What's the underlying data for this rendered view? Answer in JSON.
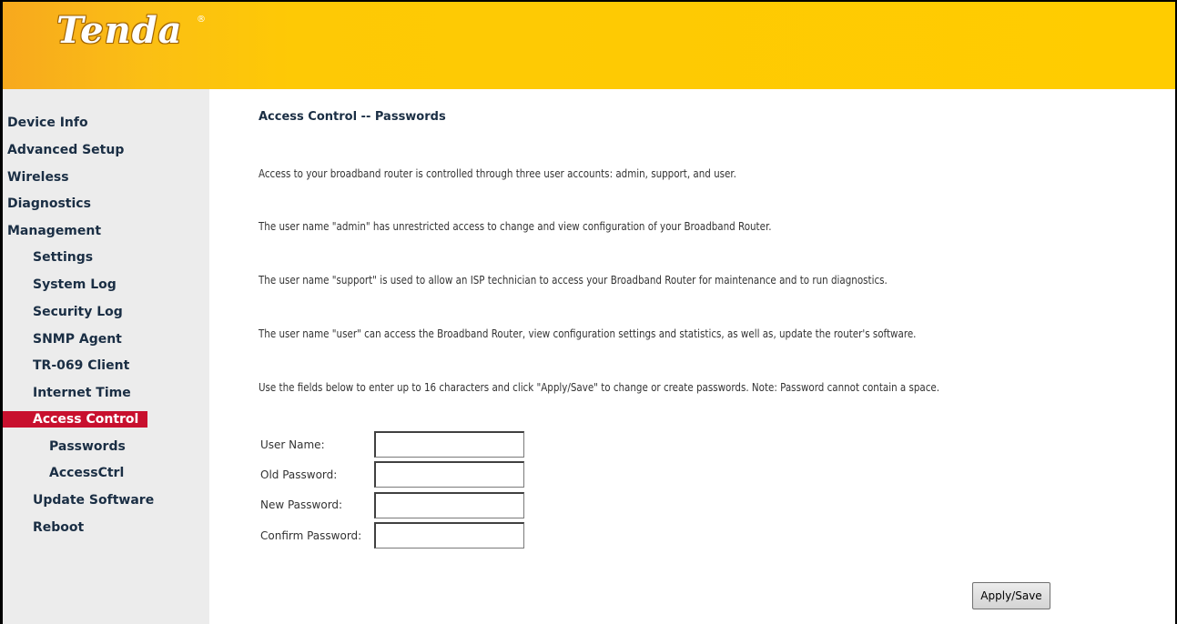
{
  "brand": {
    "logo": "Tenda",
    "reg_mark": "®",
    "header_color": "#ffcc00",
    "accent": "#c8102e"
  },
  "sidebar": {
    "items": [
      {
        "label": "Device Info"
      },
      {
        "label": "Advanced Setup"
      },
      {
        "label": "Wireless"
      },
      {
        "label": "Diagnostics"
      },
      {
        "label": "Management"
      },
      {
        "label": "Settings"
      },
      {
        "label": "System Log"
      },
      {
        "label": "Security Log"
      },
      {
        "label": "SNMP Agent"
      },
      {
        "label": "TR-069 Client"
      },
      {
        "label": "Internet Time"
      },
      {
        "label": "Access Control"
      },
      {
        "label": "Passwords"
      },
      {
        "label": "AccessCtrl"
      },
      {
        "label": "Update Software"
      },
      {
        "label": "Reboot"
      }
    ],
    "active": "Access Control"
  },
  "main": {
    "title": "Access Control -- Passwords",
    "paragraphs": [
      "Access to your broadband router is controlled through three user accounts: admin, support, and user.",
      "The user name \"admin\" has unrestricted access to change and view configuration of your Broadband Router.",
      "The user name \"support\" is used to allow an ISP technician to access your Broadband Router for maintenance and to run diagnostics.",
      "The user name \"user\" can access the Broadband Router, view configuration settings and statistics, as well as, update the router's software.",
      "Use the fields below to enter up to 16 characters and click \"Apply/Save\" to change or create passwords. Note: Password cannot contain a space."
    ],
    "form": {
      "fields": [
        {
          "label": "User Name:",
          "value": ""
        },
        {
          "label": "Old Password:",
          "value": ""
        },
        {
          "label": "New Password:",
          "value": ""
        },
        {
          "label": "Confirm Password:",
          "value": ""
        }
      ],
      "apply_label": "Apply/Save"
    }
  }
}
